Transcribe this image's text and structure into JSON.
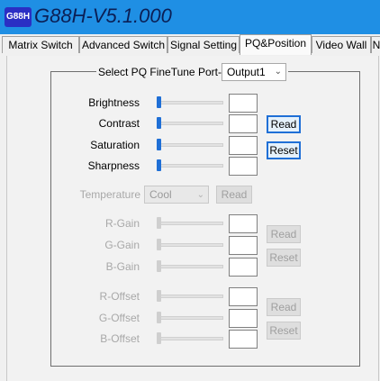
{
  "app": {
    "badge": "G88H",
    "title": "G88H-V5.1.000"
  },
  "tabs": [
    {
      "label": "Matrix Switch"
    },
    {
      "label": "Advanced Switch"
    },
    {
      "label": "Signal Setting"
    },
    {
      "label": "PQ&Position",
      "active": true
    },
    {
      "label": "Video Wall"
    },
    {
      "label": "N"
    }
  ],
  "pq": {
    "select_label": "Select PQ FineTune Port-",
    "port_value": "Output1",
    "brightness": {
      "label": "Brightness",
      "value": ""
    },
    "contrast": {
      "label": "Contrast",
      "value": ""
    },
    "saturation": {
      "label": "Saturation",
      "value": ""
    },
    "sharpness": {
      "label": "Sharpness",
      "value": ""
    },
    "read_label": "Read",
    "reset_label": "Reset"
  },
  "temperature": {
    "label": "Temperature",
    "value": "Cool",
    "read_label": "Read"
  },
  "gain": {
    "r_label": "R-Gain",
    "g_label": "G-Gain",
    "b_label": "B-Gain",
    "read_label": "Read",
    "reset_label": "Reset"
  },
  "offset": {
    "r_label": "R-Offset",
    "g_label": "G-Offset",
    "b_label": "B-Offset",
    "read_label": "Read",
    "reset_label": "Reset"
  },
  "colors": {
    "titlebar": "#1f8fe4",
    "badge": "#2a2fc4",
    "accent": "#1f6fd6"
  },
  "icons": {
    "dropdown": "chevron-down-icon"
  }
}
